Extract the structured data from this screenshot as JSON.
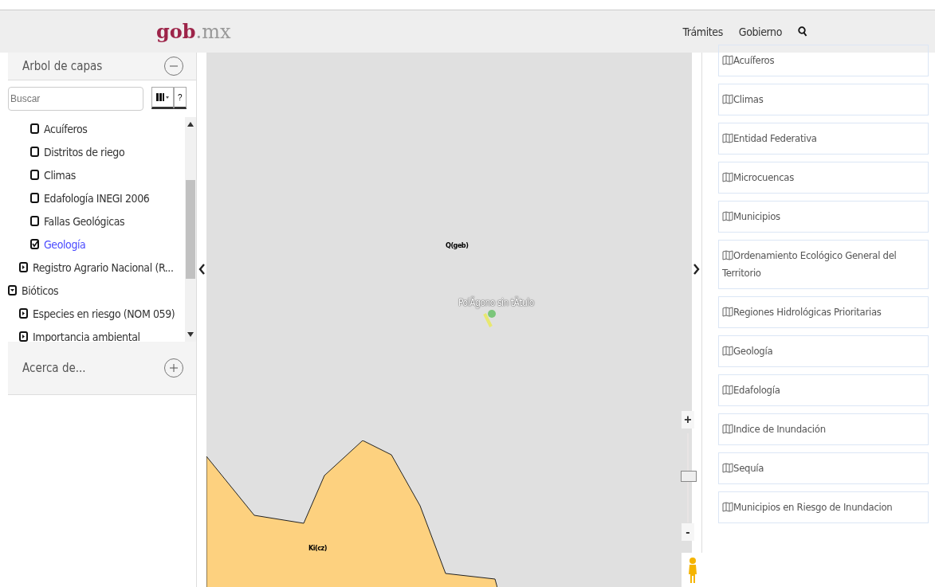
{
  "header": {
    "logo_bold": "gob",
    "logo_rest": ".mx",
    "nav": [
      "Trámites",
      "Gobierno"
    ]
  },
  "left_panel": {
    "title": "Arbol de capas",
    "expanded": true,
    "search": {
      "placeholder": "Buscar"
    },
    "help": "?",
    "tree": [
      {
        "children": [
          {
            "children": [
              {
                "label": "Acuíferos",
                "kind": "layer",
                "checked": false
              },
              {
                "label": "Distritos de riego",
                "kind": "layer",
                "checked": false
              },
              {
                "label": "Climas",
                "kind": "layer",
                "checked": false
              },
              {
                "label": "Edafología INEGI 2006",
                "kind": "layer",
                "checked": false
              },
              {
                "label": "Fallas Geológicas",
                "kind": "layer",
                "checked": false
              },
              {
                "label": "Geología",
                "kind": "layer",
                "checked": true
              }
            ]
          },
          {
            "label": "Registro Agrario Nacional (R...",
            "kind": "group",
            "expanded": false
          }
        ]
      },
      {
        "label": "Bióticos",
        "kind": "group",
        "expanded": true,
        "children": [
          {
            "label": "Especies en riesgo (NOM 059)",
            "kind": "group",
            "expanded": false
          },
          {
            "label": "Importancia ambiental",
            "kind": "group",
            "expanded": false
          }
        ]
      }
    ],
    "about": {
      "title": "Acerca de...",
      "expanded": false
    }
  },
  "map": {
    "labels": [
      {
        "text": "Q(geb)",
        "kind": "unit"
      },
      {
        "text": "PolÃgono sin tÃtulo",
        "kind": "polygon"
      },
      {
        "text": "Ki(cz)",
        "kind": "unit"
      }
    ],
    "zoom": {
      "level": 0.5,
      "plus": "+",
      "minus": "-"
    }
  },
  "right_panel": {
    "items": [
      "Acuíferos",
      "Climas",
      "Entidad Federativa",
      "Microcuencas",
      "Municipios",
      "Ordenamiento Ecológico General del Territorio",
      "Regiones Hidrológicas Prioritarias",
      "Geología",
      "Edafología",
      "Indice de Inundación",
      "Sequía",
      "Municipios en Riesgo de Inundacion"
    ]
  }
}
